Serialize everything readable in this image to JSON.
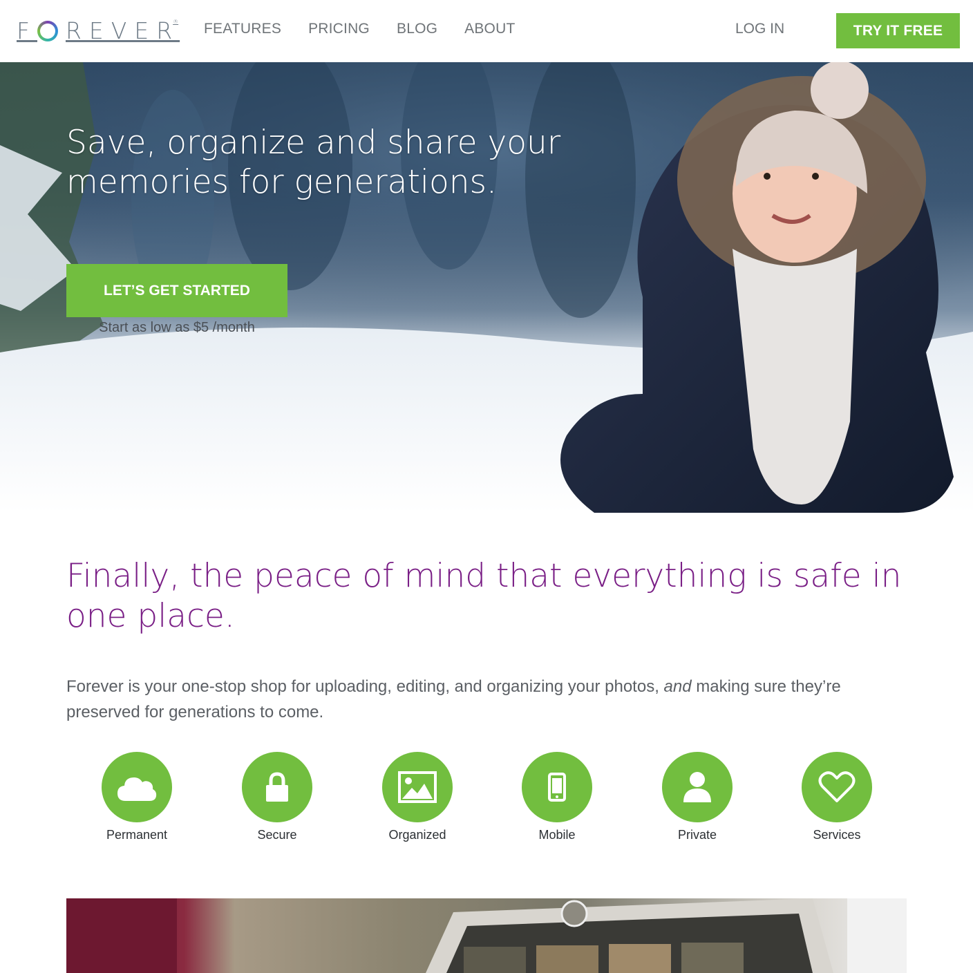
{
  "header": {
    "logo_text": "FOREVER",
    "nav": [
      {
        "label": "FEATURES"
      },
      {
        "label": "PRICING"
      },
      {
        "label": "BLOG"
      },
      {
        "label": "ABOUT"
      }
    ],
    "login_label": "LOG IN",
    "try_label": "TRY IT FREE"
  },
  "hero": {
    "title": "Save, organize and share your memories for generations.",
    "cta_label": "LET’S GET STARTED",
    "cta_sub": "Start as low as $5 /month"
  },
  "intro": {
    "headline": "Finally, the peace of mind that everything is safe in one place.",
    "desc_before": "Forever is your one-stop shop for uploading, editing, and organizing your photos,",
    "desc_em": "and",
    "desc_after": "making sure they’re preserved for generations to come."
  },
  "features": [
    {
      "label": "Permanent",
      "icon": "cloud-icon"
    },
    {
      "label": "Secure",
      "icon": "lock-icon"
    },
    {
      "label": "Organized",
      "icon": "photo-icon"
    },
    {
      "label": "Mobile",
      "icon": "phone-icon"
    },
    {
      "label": "Private",
      "icon": "user-icon"
    },
    {
      "label": "Services",
      "icon": "heart-icon"
    }
  ],
  "colors": {
    "accent_green": "#72be3f",
    "headline_purple": "#7a1f86",
    "nav_gray": "#6f7478"
  }
}
